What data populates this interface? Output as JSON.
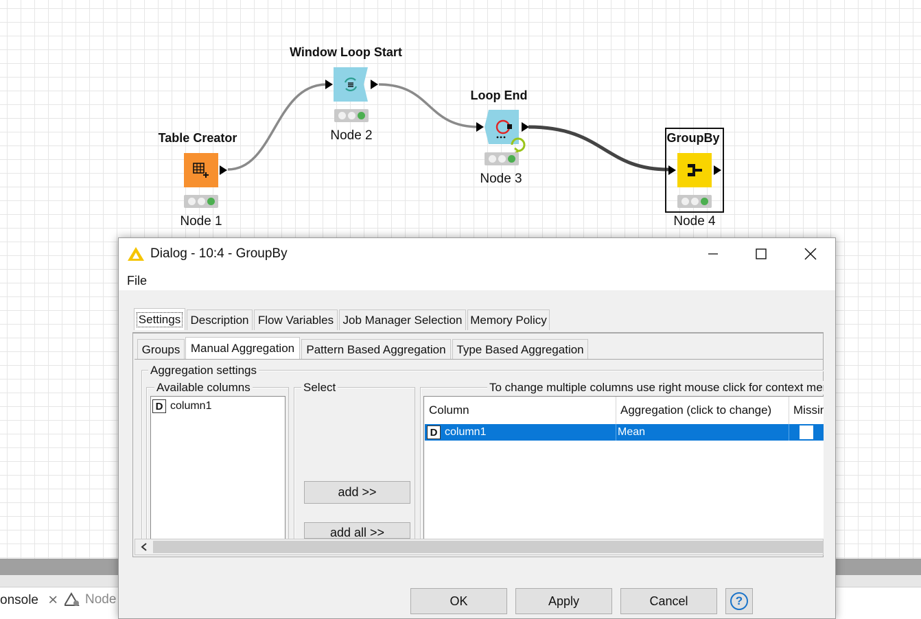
{
  "workflow": {
    "nodes": [
      {
        "title": "Table Creator",
        "label": "Node 1",
        "color": "#f7902f",
        "icon": "table-plus-icon"
      },
      {
        "title": "Window Loop Start",
        "label": "Node 2",
        "color": "#8fd3e6",
        "icon": "loop-start-icon"
      },
      {
        "title": "Loop End",
        "label": "Node 3",
        "color": "#8fd3e6",
        "icon": "loop-end-icon"
      },
      {
        "title": "GroupBy",
        "label": "Node 4",
        "color": "#f9d400",
        "icon": "groupby-icon"
      }
    ]
  },
  "console": {
    "tab1": "onsole",
    "tab2": "Node"
  },
  "dialog": {
    "title": "Dialog - 10:4 - GroupBy",
    "menu": {
      "file": "File"
    },
    "main_tabs": [
      "Settings",
      "Description",
      "Flow Variables",
      "Job Manager Selection",
      "Memory Policy"
    ],
    "sub_tabs": [
      "Groups",
      "Manual Aggregation",
      "Pattern Based Aggregation",
      "Type Based Aggregation"
    ],
    "aggregation_settings_label": "Aggregation settings",
    "available_columns_label": "Available columns",
    "available_columns": [
      {
        "type": "D",
        "name": "column1"
      }
    ],
    "select_label": "Select",
    "add_button": "add >>",
    "add_all_button": "add all >>",
    "hint": "To change multiple columns use right mouse click for context men",
    "table": {
      "headers": [
        "Column",
        "Aggregation (click to change)",
        "Missin"
      ],
      "rows": [
        {
          "type": "D",
          "column": "column1",
          "aggregation": "Mean",
          "missing": false
        }
      ]
    },
    "buttons": {
      "ok": "OK",
      "apply": "Apply",
      "cancel": "Cancel",
      "help": "?"
    }
  },
  "colors": {
    "selection": "#0a78d7",
    "warning": "#f5c400"
  }
}
